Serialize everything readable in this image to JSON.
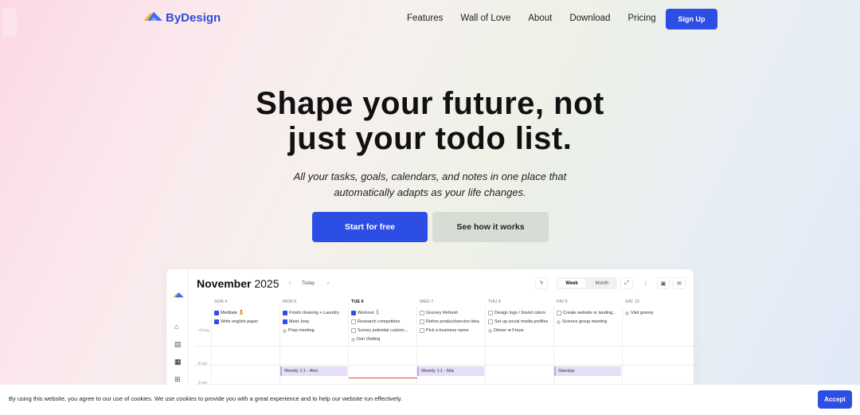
{
  "brand": {
    "name": "ByDesign",
    "color": "#2d4ee5"
  },
  "nav": {
    "links": [
      "Features",
      "Wall of Love",
      "About",
      "Download",
      "Pricing"
    ],
    "signup_label": "Sign Up"
  },
  "hero": {
    "title_line1": "Shape your future, not",
    "title_line2": "just your todo list.",
    "subtitle_line1": "All your tasks, goals, calendars, and notes in one place that",
    "subtitle_line2": "automatically adapts as your life changes.",
    "primary_cta": "Start for free",
    "secondary_cta": "See how it works"
  },
  "app_preview": {
    "month": "November",
    "year": "2025",
    "today_label": "Today",
    "view_week": "Week",
    "view_month": "Month",
    "all_day_label": "All Day",
    "days": [
      {
        "label": "SUN 4",
        "today": false
      },
      {
        "label": "MON 5",
        "today": false
      },
      {
        "label": "TUE 6",
        "today": true
      },
      {
        "label": "WED 7",
        "today": false
      },
      {
        "label": "THU 8",
        "today": false
      },
      {
        "label": "FRI 9",
        "today": false
      },
      {
        "label": "SAT 10",
        "today": false
      }
    ],
    "tasks": [
      [
        {
          "text": "Meditate 🧘",
          "done": true
        },
        {
          "text": "Write english paper",
          "done": true
        }
      ],
      [
        {
          "text": "Finish cleaning + Laundry",
          "done": true
        },
        {
          "text": "Meet Joey",
          "done": true
        },
        {
          "text": "Prep meeting",
          "done": false,
          "type": "dot"
        }
      ],
      [
        {
          "text": "Workout 🏃",
          "done": true
        },
        {
          "text": "Research competitors",
          "done": false
        },
        {
          "text": "Survey potential custom...",
          "done": false
        },
        {
          "text": "Don Visiting",
          "done": false,
          "type": "dot"
        }
      ],
      [
        {
          "text": "Grocery Refresh",
          "done": false
        },
        {
          "text": "Refine product/service idea",
          "done": false
        },
        {
          "text": "Pick a business name",
          "done": false
        }
      ],
      [
        {
          "text": "Design logo / brand colors",
          "done": false
        },
        {
          "text": "Set up social media profiles",
          "done": false
        },
        {
          "text": "Dinner w Freya",
          "done": false,
          "type": "dot"
        }
      ],
      [
        {
          "text": "Create website or landing...",
          "done": false
        },
        {
          "text": "Science group meeting",
          "done": false,
          "type": "dot"
        }
      ],
      [
        {
          "text": "Visit granny",
          "done": false,
          "type": "dot"
        }
      ]
    ],
    "times": [
      "8 am",
      "9 am"
    ],
    "events": [
      {
        "day": 1,
        "text": "Weekly 1:1 - Alex"
      },
      {
        "day": 3,
        "text": "Weekly 1:1 - Mia"
      },
      {
        "day": 5,
        "text": "Standup"
      }
    ]
  },
  "cookie": {
    "text": "By using this website, you agree to our use of cookies. We use cookies to provide you with a great experience and to help our website run effectively.",
    "accept_label": "Accept"
  }
}
